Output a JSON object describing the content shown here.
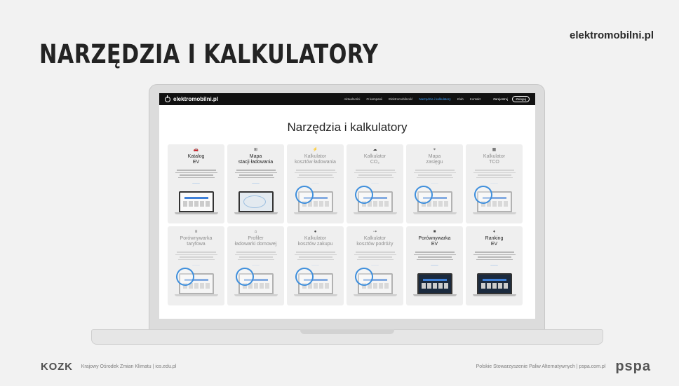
{
  "slide": {
    "title": "NARZĘDZIA I KALKULATORY",
    "brand": "elektromobilni.pl"
  },
  "site": {
    "logo_text": "elektromobilni.pl",
    "nav": [
      "Aktualności",
      "O kampanii",
      "Elektromobilność",
      "Narzędzia i kalkulatory",
      "Klub",
      "Kontakt"
    ],
    "nav_active": "Narzędzia i kalkulatory",
    "register": "Zarejestruj",
    "login": "Zaloguj",
    "heading": "Narzędzia i kalkulatory",
    "cards": [
      {
        "title": "Katalog\nEV",
        "icon": "car-icon",
        "glyph": "🚗",
        "active": true
      },
      {
        "title": "Mapa\nstacji ładowania",
        "icon": "charger-icon",
        "glyph": "⊞",
        "active": true
      },
      {
        "title": "Kalkulator\nkosztów ładowania",
        "icon": "plug-icon",
        "glyph": "⚡",
        "active": false
      },
      {
        "title": "Kalkulator\nCO₂",
        "icon": "co2-icon",
        "glyph": "☁",
        "active": false
      },
      {
        "title": "Mapa\nzasięgu",
        "icon": "range-icon",
        "glyph": "⌖",
        "active": false
      },
      {
        "title": "Kalkulator\nTCO",
        "icon": "calculator-icon",
        "glyph": "▦",
        "active": false
      },
      {
        "title": "Porównywarka\ntaryfowa",
        "icon": "tariff-icon",
        "glyph": "≡",
        "active": false
      },
      {
        "title": "Profiler\nładowarki domowej",
        "icon": "home-charger-icon",
        "glyph": "⌂",
        "active": false
      },
      {
        "title": "Kalkulator\nkosztów zakupu",
        "icon": "purchase-icon",
        "glyph": "●",
        "active": false
      },
      {
        "title": "Kalkulator\nkosztów podróży",
        "icon": "trip-icon",
        "glyph": "⇢",
        "active": false
      },
      {
        "title": "Porównywarka\nEV",
        "icon": "compare-icon",
        "glyph": "■",
        "active": true
      },
      {
        "title": "Ranking\nEV",
        "icon": "ranking-icon",
        "glyph": "♦",
        "active": true
      }
    ]
  },
  "footer": {
    "left_logo": "KOZK",
    "left_text": "Krajowy Ośrodek Zmian Klimatu  |  ios.edu.pl",
    "right_text": "Polskie Stowarzyszenie Paliw Alternatywnych  |  pspa.com.pl",
    "right_logo": "pspa"
  }
}
